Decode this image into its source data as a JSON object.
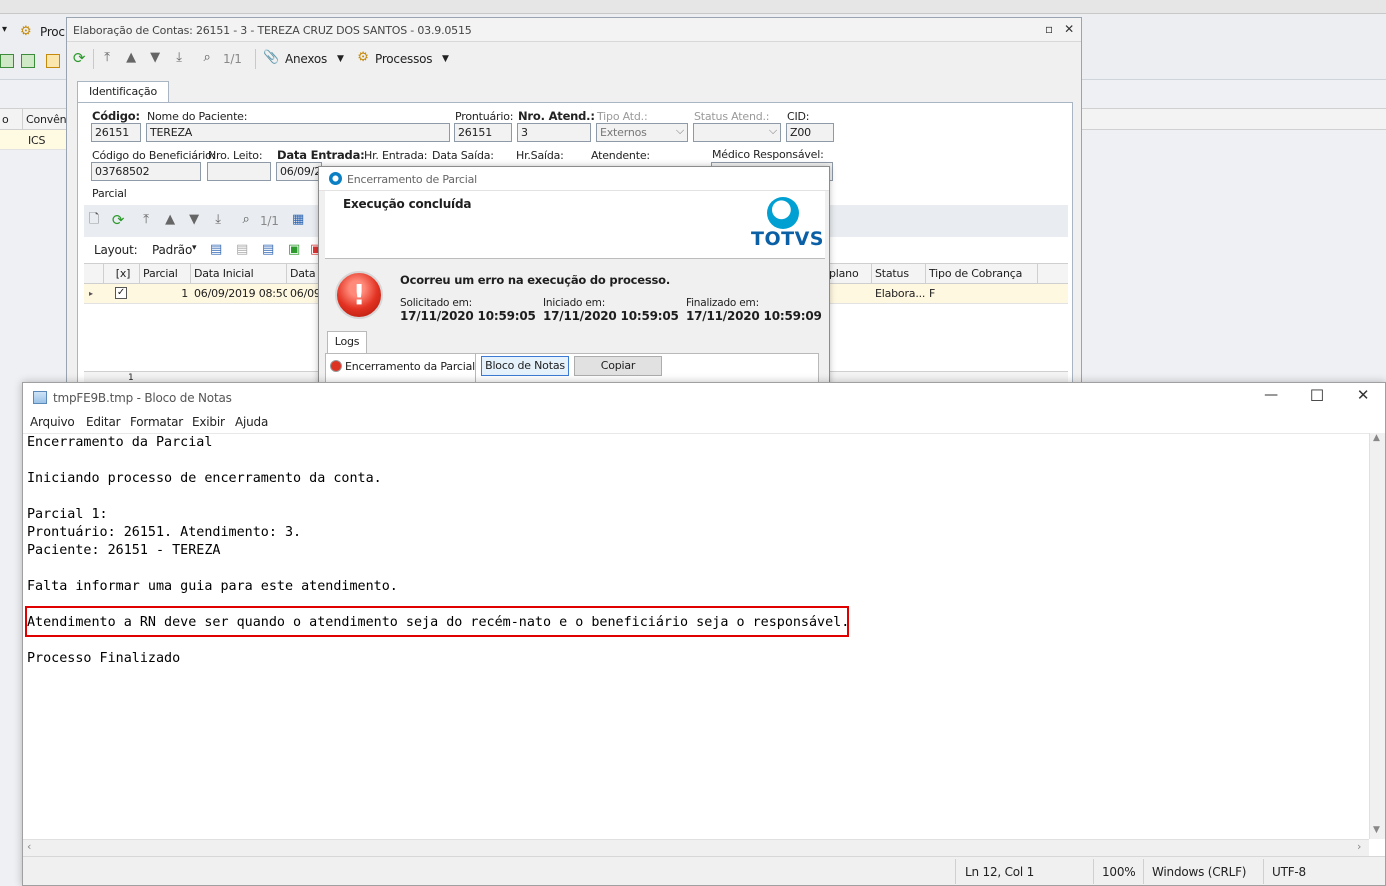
{
  "background_app": {
    "toolbar_partial_label": "Proc",
    "grid_header_col1": "o",
    "grid_header_col2": "Convêni",
    "grid_row_value": "ICS"
  },
  "main_window": {
    "title": "Elaboração de Contas: 26151 - 3 - TEREZA CRUZ DOS SANTOS - 03.9.0515",
    "toolbar": {
      "pager": "1/1",
      "anexos": "Anexos",
      "processos": "Processos"
    },
    "tab": "Identificação",
    "form": {
      "codigo_label": "Código:",
      "codigo_value": "26151",
      "nome_label": "Nome do Paciente:",
      "nome_value": "TEREZA",
      "prontuario_label": "Prontuário:",
      "prontuario_value": "26151",
      "nro_atend_label": "Nro. Atend.:",
      "nro_atend_value": "3",
      "tipo_atd_label": "Tipo Atd.:",
      "tipo_atd_value": "Externos",
      "status_atend_label": "Status Atend.:",
      "status_atend_value": "",
      "cid_label": "CID:",
      "cid_value": "Z00",
      "cod_benef_label": "Código do Beneficiário:",
      "cod_benef_value": "03768502",
      "nro_leito_label": "Nro. Leito:",
      "nro_leito_value": "",
      "data_entrada_label": "Data Entrada:",
      "data_entrada_value": "06/09/2",
      "hr_entrada_label": "Hr. Entrada:",
      "data_saida_label": "Data Saída:",
      "hr_saida_label": "Hr.Saída:",
      "atendente_label": "Atendente:",
      "medico_label": "Médico Responsável:"
    },
    "parcial_group": "Parcial",
    "grid_pager": "1/1",
    "layout_label": "Layout:",
    "layout_value": "Padrão",
    "grid": {
      "headers": [
        "[x]",
        "Parcial",
        "Data Inicial",
        "Data",
        "plano",
        "Status",
        "Tipo de Cobrança"
      ],
      "row": {
        "checked": true,
        "parcial": "1",
        "data_inicial": "06/09/2019 08:50",
        "data": "06/09",
        "status": "Elabora...",
        "tipo_cobranca": "F"
      },
      "footer_count": "1"
    }
  },
  "dialog": {
    "title": "Encerramento de Parcial",
    "header": "Execução concluída",
    "logo_text": "TOTVS",
    "message": "Ocorreu um erro na execução do processo.",
    "solicitado_label": "Solicitado em:",
    "solicitado_value": "17/11/2020 10:59:05",
    "iniciado_label": "Iniciado em:",
    "iniciado_value": "17/11/2020 10:59:05",
    "finalizado_label": "Finalizado em:",
    "finalizado_value": "17/11/2020 10:59:09",
    "logs_tab": "Logs",
    "log_item": "Encerramento da Parcial",
    "btn_bloco": "Bloco de Notas",
    "btn_copiar": "Copiar"
  },
  "notepad": {
    "title": "tmpFE9B.tmp - Bloco de Notas",
    "menu": [
      "Arquivo",
      "Editar",
      "Formatar",
      "Exibir",
      "Ajuda"
    ],
    "lines": [
      "Encerramento da Parcial",
      "",
      "Iniciando processo de encerramento da conta.",
      "",
      "Parcial 1:",
      "Prontuário: 26151. Atendimento: 3.",
      "Paciente: 26151 - TEREZA",
      "",
      "Falta informar uma guia para este atendimento.",
      "",
      "Atendimento a RN deve ser quando o atendimento seja do recém-nato e o beneficiário seja o responsável.",
      "",
      "Processo Finalizado"
    ],
    "highlighted_line_index": 10,
    "highlight_color": "#e00000",
    "status": {
      "position": "Ln 12, Col 1",
      "zoom": "100%",
      "line_ending": "Windows (CRLF)",
      "encoding": "UTF-8"
    }
  }
}
